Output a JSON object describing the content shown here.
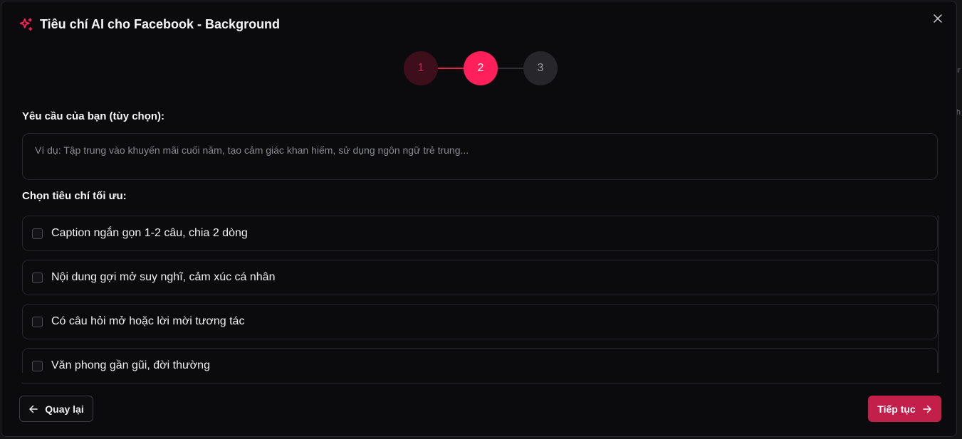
{
  "dialog": {
    "title": "Tiêu chí AI cho Facebook - Background",
    "title_icon": "sparkles-icon",
    "close_icon": "close-icon",
    "accent_color": "#ff1f5b"
  },
  "stepper": {
    "current_step": 2,
    "steps": [
      {
        "label": "1",
        "state": "completed"
      },
      {
        "label": "2",
        "state": "active"
      },
      {
        "label": "3",
        "state": "pending"
      }
    ]
  },
  "request": {
    "label": "Yêu cầu của bạn (tùy chọn):",
    "value": "",
    "placeholder": "Ví dụ: Tập trung vào khuyến mãi cuối năm, tạo cảm giác khan hiếm, sử dụng ngôn ngữ trẻ trung..."
  },
  "criteria": {
    "label": "Chọn tiêu chí tối ưu:",
    "items": [
      {
        "label": "Caption ngắn gọn 1-2 câu, chia 2 dòng",
        "checked": false
      },
      {
        "label": "Nội dung gợi mở suy nghĩ, cảm xúc cá nhân",
        "checked": false
      },
      {
        "label": "Có câu hỏi mở hoặc lời mời tương tác",
        "checked": false
      },
      {
        "label": "Văn phong gần gũi, đời thường",
        "checked": false
      }
    ]
  },
  "footer": {
    "back_label": "Quay lại",
    "back_icon": "arrow-left-icon",
    "next_label": "Tiếp tục",
    "next_icon": "arrow-right-icon",
    "next_color": "#c21f4a"
  }
}
